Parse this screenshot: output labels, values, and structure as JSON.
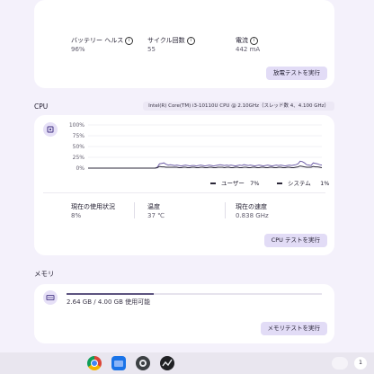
{
  "battery": {
    "stats": [
      {
        "label": "バッテリー ヘルス",
        "value": "96%"
      },
      {
        "label": "サイクル回数",
        "value": "55"
      },
      {
        "label": "電流",
        "value": "442 mA"
      }
    ],
    "button": "放電テストを実行"
  },
  "cpu": {
    "title": "CPU",
    "chip": "Intel(R) Core(TM) i3-10110U CPU @ 2.10GHz（スレッド数 4、4.100 GHz）",
    "yticks": [
      "100%",
      "75%",
      "50%",
      "25%",
      "0%"
    ],
    "legend": [
      {
        "name": "ユーザー",
        "value": "7%"
      },
      {
        "name": "システム",
        "value": "1%"
      }
    ],
    "stats": [
      {
        "label": "現在の使用状況",
        "value": "8%"
      },
      {
        "label": "温度",
        "value": "37 ℃"
      },
      {
        "label": "現在の速度",
        "value": "0.838 GHz"
      }
    ],
    "button": "CPU テストを実行"
  },
  "memory": {
    "title": "メモリ",
    "usage": "2.64 GB / 4.00 GB 使用可能",
    "used_fraction": 0.34,
    "button": "メモリテストを実行"
  },
  "shelf": {
    "apps": [
      "chrome-icon",
      "files-icon",
      "settings-icon",
      "diagnostics-icon"
    ],
    "notification_count": "1"
  },
  "colors": {
    "accent": "#6f5fa8",
    "user_line": "#6f5fa8",
    "system_line": "#2b2738"
  },
  "chart_data": {
    "type": "line",
    "ylim": [
      0,
      100
    ],
    "series": [
      {
        "name": "ユーザー",
        "values": [
          0,
          0,
          0,
          0,
          0,
          0,
          0,
          0,
          0,
          0,
          0,
          0,
          0,
          0,
          0,
          0,
          0,
          0,
          0,
          0,
          0,
          0,
          0,
          0,
          0,
          0,
          0,
          0,
          0,
          0,
          0,
          0,
          2,
          10,
          11,
          12,
          9,
          7,
          8,
          7,
          6,
          7,
          6,
          5,
          6,
          7,
          6,
          5,
          6,
          6,
          5,
          6,
          7,
          6,
          5,
          6,
          7,
          6,
          5,
          6,
          7,
          8,
          7,
          6,
          7,
          6,
          7,
          6,
          5,
          6,
          7,
          6,
          8,
          7,
          6,
          7,
          6,
          5,
          6,
          7,
          6,
          5,
          6,
          7,
          6,
          5,
          6,
          7,
          6,
          7,
          6,
          5,
          6,
          7,
          6,
          7,
          8,
          10,
          16,
          15,
          12,
          8,
          7,
          6,
          12,
          11,
          10,
          8,
          7
        ]
      },
      {
        "name": "システム",
        "values": [
          0,
          0,
          0,
          0,
          0,
          0,
          0,
          0,
          0,
          0,
          0,
          0,
          0,
          0,
          0,
          0,
          0,
          0,
          0,
          0,
          0,
          0,
          0,
          0,
          0,
          0,
          0,
          0,
          0,
          0,
          0,
          0,
          1,
          4,
          3,
          3,
          2,
          2,
          2,
          2,
          2,
          2,
          1,
          1,
          2,
          2,
          1,
          1,
          2,
          2,
          1,
          1,
          2,
          2,
          1,
          1,
          2,
          2,
          1,
          1,
          2,
          2,
          2,
          1,
          2,
          2,
          1,
          1,
          2,
          2,
          1,
          1,
          2,
          2,
          1,
          1,
          2,
          2,
          1,
          1,
          2,
          2,
          1,
          1,
          2,
          2,
          1,
          1,
          2,
          2,
          1,
          1,
          2,
          2,
          1,
          1,
          2,
          3,
          5,
          4,
          3,
          2,
          2,
          2,
          4,
          3,
          3,
          2,
          1
        ]
      }
    ]
  }
}
